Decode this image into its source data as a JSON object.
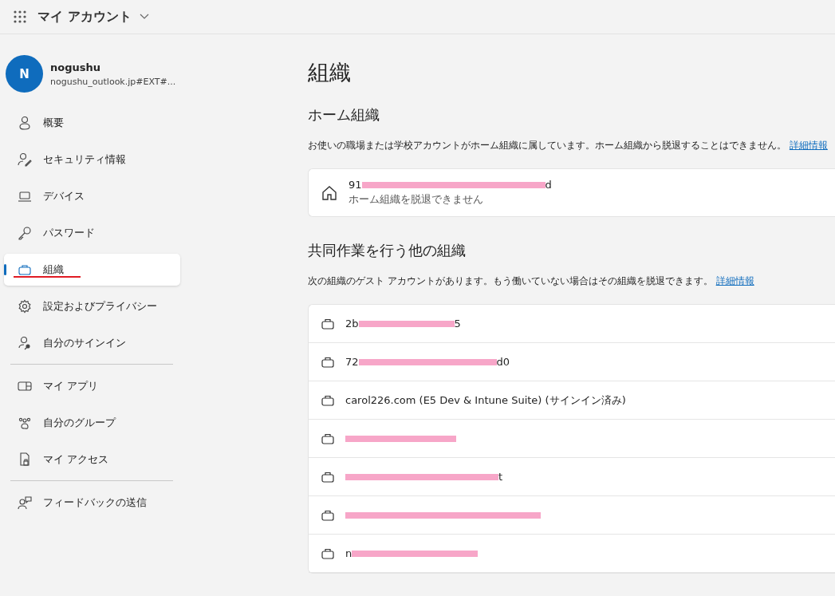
{
  "header": {
    "app_title": "マイ アカウント"
  },
  "profile": {
    "initial": "N",
    "name": "nogushu",
    "account": "nogushu_outlook.jp#EXT#..."
  },
  "sidebar": {
    "groups": [
      [
        {
          "label": "概要",
          "selected": false,
          "underlined": false
        },
        {
          "label": "セキュリティ情報",
          "selected": false,
          "underlined": false
        },
        {
          "label": "デバイス",
          "selected": false,
          "underlined": false
        },
        {
          "label": "パスワード",
          "selected": false,
          "underlined": false
        },
        {
          "label": "組織",
          "selected": true,
          "underlined": true
        },
        {
          "label": "設定およびプライバシー",
          "selected": false,
          "underlined": false
        },
        {
          "label": "自分のサインイン",
          "selected": false,
          "underlined": false
        }
      ],
      [
        {
          "label": "マイ アプリ",
          "selected": false,
          "underlined": false
        },
        {
          "label": "自分のグループ",
          "selected": false,
          "underlined": false
        },
        {
          "label": "マイ アクセス",
          "selected": false,
          "underlined": false
        }
      ],
      [
        {
          "label": "フィードバックの送信",
          "selected": false,
          "underlined": false
        }
      ]
    ]
  },
  "page": {
    "title": "組織",
    "home": {
      "heading": "ホーム組織",
      "description": "お使いの職場または学校アカウントがホーム組織に属しています。ホーム組織から脱退することはできません。",
      "link": "詳細情報",
      "org": {
        "before": "91",
        "redacted": true,
        "after": "d",
        "note": "ホーム組織を脱退できません"
      }
    },
    "other": {
      "heading": "共同作業を行う他の組織",
      "description": "次の組織のゲスト アカウントがあります。もう働いていない場合はその組織を脱退できます。",
      "link": "詳細情報",
      "orgs": [
        {
          "before": "2b",
          "redacted": true,
          "after": "5"
        },
        {
          "before": "72",
          "redacted": true,
          "after": "d0"
        },
        {
          "before": "carol226.com (E5 Dev & Intune Suite) (サインイン済み)",
          "redacted": false
        },
        {
          "redacted": true
        },
        {
          "redacted": true,
          "after": "t"
        },
        {
          "redacted": true
        },
        {
          "before": "n",
          "redacted": true
        }
      ]
    }
  }
}
